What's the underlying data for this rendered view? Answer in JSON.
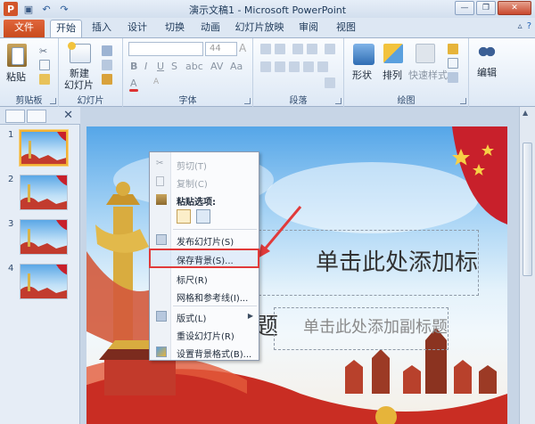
{
  "window": {
    "title": "演示文稿1 - Microsoft PowerPoint",
    "controls": [
      "—",
      "❐",
      "✕"
    ]
  },
  "qat": {
    "icons": [
      "powerpoint-logo-icon",
      "save-icon",
      "undo-icon",
      "redo-icon"
    ]
  },
  "tabs": [
    {
      "label": "文件",
      "active": false
    },
    {
      "label": "开始",
      "active": true
    },
    {
      "label": "插入",
      "active": false
    },
    {
      "label": "设计",
      "active": false
    },
    {
      "label": "切换",
      "active": false
    },
    {
      "label": "动画",
      "active": false
    },
    {
      "label": "幻灯片放映",
      "active": false
    },
    {
      "label": "审阅",
      "active": false
    },
    {
      "label": "视图",
      "active": false
    }
  ],
  "ribbon": {
    "groups": {
      "clipboard": {
        "label": "剪贴板",
        "paste": "粘贴"
      },
      "slides": {
        "label": "幻灯片",
        "new_slide_1": "新建",
        "new_slide_2": "幻灯片"
      },
      "font": {
        "label": "字体",
        "size": "44",
        "a_big": "A",
        "a_small": "A",
        "a_color": "A",
        "aa": "Aa"
      },
      "paragraph": {
        "label": "段落"
      },
      "drawing": {
        "label": "绘图",
        "shapes": "形状",
        "arrange": "排列",
        "quick_styles": "快速样式"
      },
      "editing": {
        "label": "编辑",
        "button": "编辑"
      }
    }
  },
  "slides_pane": {
    "thumbnails": [
      {
        "number": "1",
        "selected": true
      },
      {
        "number": "2",
        "selected": false
      },
      {
        "number": "3",
        "selected": false
      },
      {
        "number": "4",
        "selected": false
      }
    ]
  },
  "slide": {
    "title_placeholder": "单击此处添加标题",
    "subtitle_placeholder": "单击此处添加副标题"
  },
  "context_menu": {
    "items": [
      {
        "label": "剪切(T)",
        "icon": "scissors-icon",
        "disabled": true
      },
      {
        "label": "复制(C)",
        "icon": "copy-icon",
        "disabled": true
      },
      {
        "label": "粘贴选项:",
        "icon": "paste-icon",
        "disabled": false
      },
      {
        "label": "发布幻灯片(S)",
        "icon": "publish-slides-icon",
        "disabled": false
      },
      {
        "label": "保存背景(S)...",
        "icon": "",
        "disabled": false,
        "highlighted": true
      },
      {
        "label": "标尺(R)",
        "icon": "",
        "disabled": false
      },
      {
        "label": "网格和参考线(I)...",
        "icon": "",
        "disabled": false
      },
      {
        "label": "版式(L)",
        "icon": "layout-icon",
        "disabled": false,
        "submenu": true
      },
      {
        "label": "重设幻灯片(R)",
        "icon": "",
        "disabled": false
      },
      {
        "label": "设置背景格式(B)...",
        "icon": "format-background-icon",
        "disabled": false
      }
    ]
  },
  "colors": {
    "file_tab": "#d2552a",
    "ribbon": "#e9f0f8",
    "highlight_box": "#e13a3a",
    "annotation_arrow": "#e13a3a"
  }
}
